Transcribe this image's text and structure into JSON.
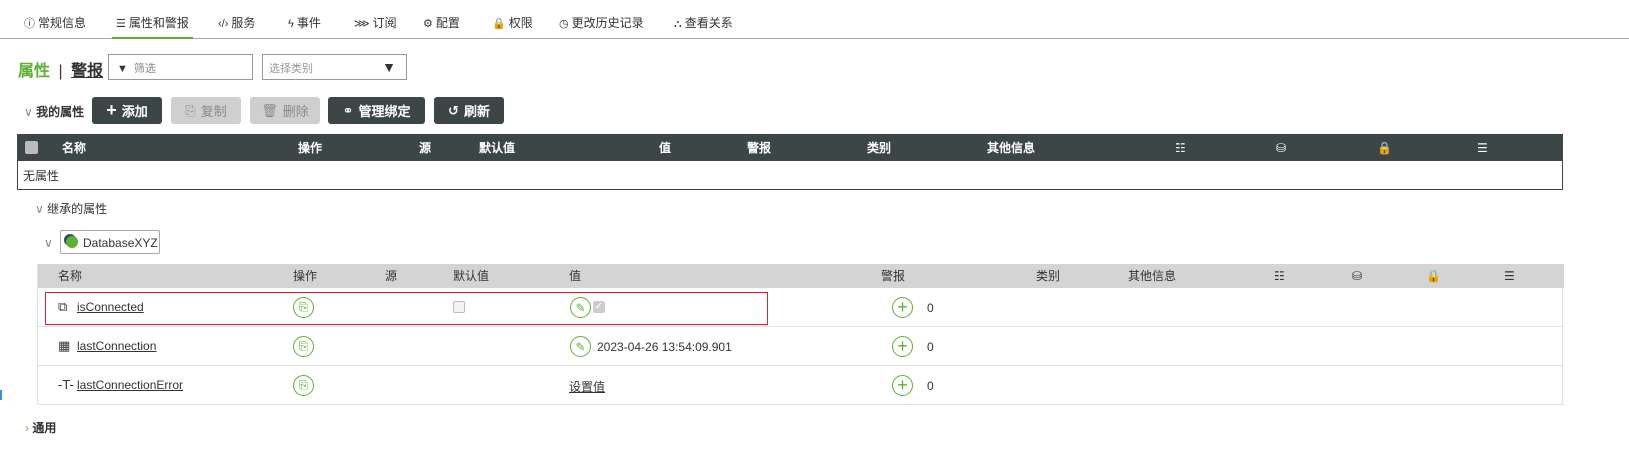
{
  "tabs": [
    {
      "icon": "info-icon",
      "glyph": "ⓘ",
      "label": "常规信息"
    },
    {
      "icon": "list-icon",
      "glyph": "☰",
      "label": "属性和警报",
      "active": true
    },
    {
      "icon": "code-icon",
      "glyph": "‹/›",
      "label": "服务"
    },
    {
      "icon": "lightning-icon",
      "glyph": "ϟ",
      "label": "事件"
    },
    {
      "icon": "rss-icon",
      "glyph": "⋙",
      "label": "订阅"
    },
    {
      "icon": "gear-icon",
      "glyph": "⚙",
      "label": "配置"
    },
    {
      "icon": "lock-icon",
      "glyph": "🔒",
      "label": "权限"
    },
    {
      "icon": "clock-icon",
      "glyph": "◷",
      "label": "更改历史记录"
    },
    {
      "icon": "hierarchy-icon",
      "glyph": "⛬",
      "label": "查看关系"
    }
  ],
  "toggle": {
    "properties": "属性",
    "separator": "|",
    "alerts": "警报"
  },
  "filter": {
    "placeholder": "筛选"
  },
  "category_select": {
    "placeholder": "选择类别"
  },
  "my_properties": {
    "label": "我的属性",
    "buttons": {
      "add": "添加",
      "copy": "复制",
      "delete": "删除",
      "manage_bindings": "管理绑定",
      "refresh": "刷新"
    },
    "columns": [
      "名称",
      "操作",
      "源",
      "默认值",
      "值",
      "警报",
      "类别",
      "其他信息"
    ],
    "icon_columns": [
      "filter-search-icon",
      "database-icon",
      "lock-icon",
      "list-icon"
    ],
    "empty_text": "无属性"
  },
  "inherited": {
    "label": "继承的属性",
    "source": "DatabaseXYZ",
    "columns": [
      "名称",
      "操作",
      "源",
      "默认值",
      "值",
      "警报",
      "类别",
      "其他信息"
    ],
    "rows": [
      {
        "icon": "boolean-icon",
        "name": "isConnected",
        "default_checked": false,
        "value_checked": true,
        "alerts": "0",
        "highlighted": true
      },
      {
        "icon": "datetime-icon",
        "name": "lastConnection",
        "value": "2023-04-26 13:54:09.901",
        "alerts": "0"
      },
      {
        "icon": "text-icon",
        "name": "lastConnectionError",
        "set_value": "设置值",
        "alerts": "0"
      }
    ]
  },
  "general": {
    "label": "通用"
  },
  "colors": {
    "accent": "#5cb130",
    "dark": "#3d4646",
    "highlight": "#e0202a"
  }
}
